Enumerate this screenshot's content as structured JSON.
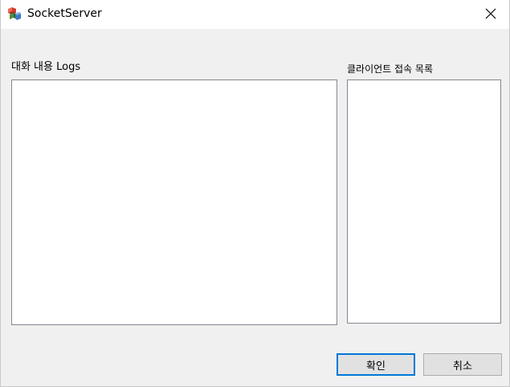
{
  "window": {
    "title": "SocketServer",
    "icon": "app-cubes-icon",
    "close_glyph": "✕"
  },
  "logs": {
    "label": "대화 내용 Logs",
    "items": []
  },
  "clients": {
    "label": "클라이언트 접속 목록",
    "items": []
  },
  "buttons": {
    "ok_label": "확인",
    "cancel_label": "취소"
  },
  "colors": {
    "focus_border": "#0078d7",
    "window_bg": "#f0f0f0",
    "titlebar_bg": "#ffffff"
  }
}
